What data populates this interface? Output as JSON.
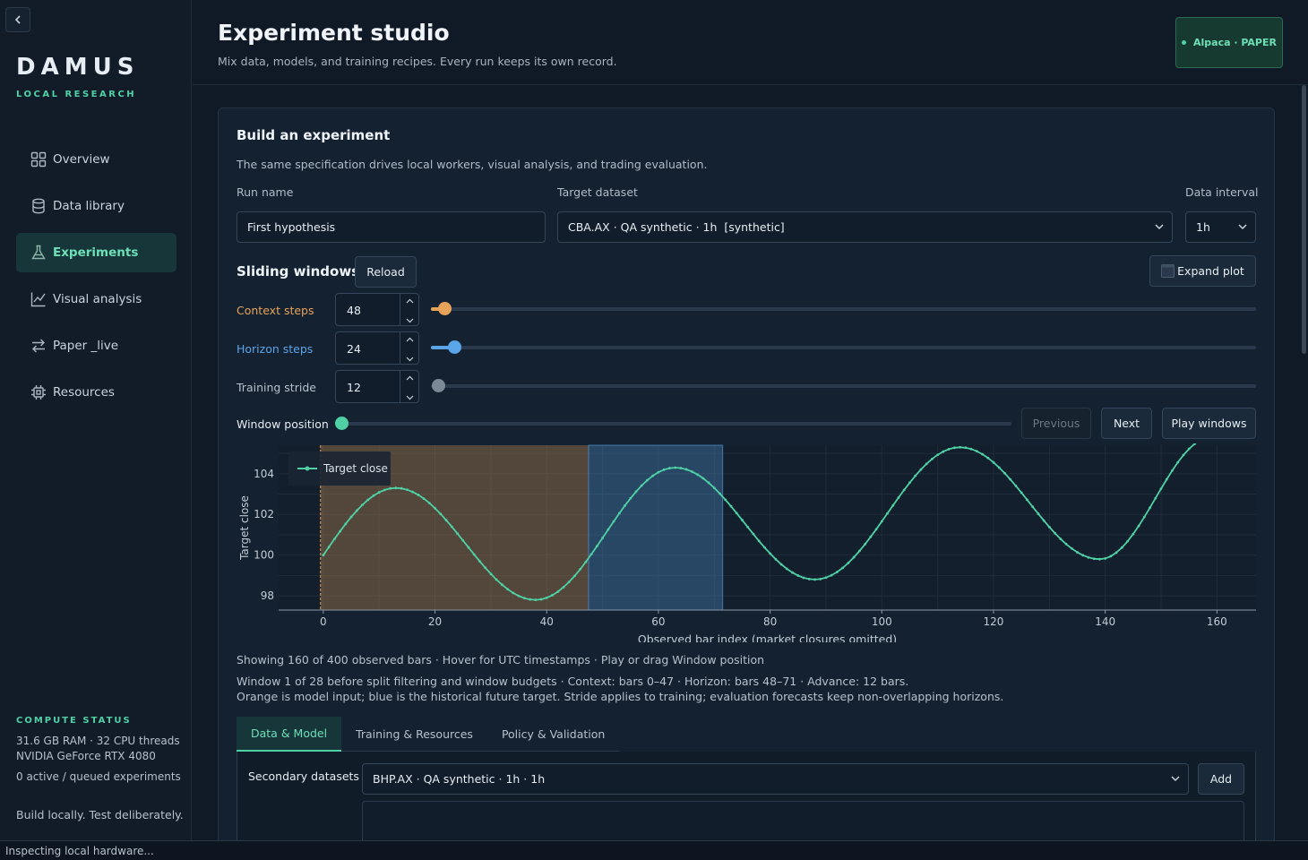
{
  "sidebar": {
    "brand": "DAMUS",
    "brand_sub": "LOCAL RESEARCH",
    "items": [
      {
        "label": "Overview",
        "icon": "grid-icon"
      },
      {
        "label": "Data library",
        "icon": "database-icon"
      },
      {
        "label": "Experiments",
        "icon": "flask-icon"
      },
      {
        "label": "Visual analysis",
        "icon": "line-chart-icon"
      },
      {
        "label": "Paper _live",
        "icon": "swap-arrows-icon"
      },
      {
        "label": "Resources",
        "icon": "chip-icon"
      }
    ],
    "active": "Experiments",
    "compute_title": "COMPUTE STATUS",
    "compute_lines": [
      "31.6 GB RAM · 32 CPU threads",
      "NVIDIA GeForce RTX 4080",
      "0 active / queued experiments"
    ],
    "tagline": "Build locally. Test deliberately."
  },
  "status_bar": "Inspecting local hardware...",
  "header": {
    "title": "Experiment studio",
    "subtitle": "Mix data, models, and training recipes. Every run keeps its own record.",
    "broker_badge": "Alpaca · PAPER"
  },
  "builder": {
    "title": "Build an experiment",
    "description": "The same specification drives local workers, visual analysis, and trading evaluation.",
    "run_name_label": "Run name",
    "run_name_value": "First hypothesis",
    "dataset_label": "Target dataset",
    "dataset_value": "CBA.AX · QA synthetic · 1h  [synthetic]",
    "interval_label": "Data interval",
    "interval_value": "1h"
  },
  "windows": {
    "title": "Sliding windows",
    "reload": "Reload",
    "expand": "Expand plot",
    "context_label": "Context steps",
    "context_value": "48",
    "horizon_label": "Horizon steps",
    "horizon_value": "24",
    "stride_label": "Training stride",
    "stride_value": "12",
    "position_label": "Window position",
    "previous": "Previous",
    "next": "Next",
    "play": "Play windows",
    "colors": {
      "context": "#e8a35a",
      "horizon": "#5aa5e8",
      "series": "#4fd1a5"
    }
  },
  "chart_data": {
    "type": "line",
    "xlabel": "Observed bar index (market closures omitted)",
    "ylabel": "Target close",
    "xlim": [
      -8,
      167
    ],
    "ylim": [
      97.3,
      105.4
    ],
    "xticks": [
      0,
      20,
      40,
      60,
      80,
      100,
      120,
      140,
      160
    ],
    "yticks": [
      98,
      100,
      102,
      104
    ],
    "legend": "top-left",
    "context_range": [
      0,
      47
    ],
    "horizon_range": [
      48,
      71
    ],
    "series": [
      {
        "name": "Target close",
        "start_x": 0,
        "end_x": 159,
        "values_formula_hint": "",
        "keypoints": [
          [
            0,
            100.0
          ],
          [
            13,
            103.3
          ],
          [
            38,
            97.8
          ],
          [
            63,
            104.3
          ],
          [
            88,
            98.8
          ],
          [
            114,
            105.3
          ],
          [
            139,
            99.8
          ],
          [
            159,
            105.8
          ]
        ]
      }
    ]
  },
  "info": {
    "showing": "Showing 160 of 400 observed bars · Hover for UTC timestamps · Play or drag Window position",
    "window": "Window 1 of 28 before split filtering and window budgets · Context: bars 0–47 · Horizon: bars 48–71 · Advance: 12 bars.",
    "legend_note": "Orange is model input; blue is the historical future target. Stride applies to training; evaluation forecasts keep non-overlapping horizons."
  },
  "tabs": [
    "Data & Model",
    "Training & Resources",
    "Policy & Validation"
  ],
  "active_tab": "Data & Model",
  "secondary": {
    "label": "Secondary datasets",
    "value": "BHP.AX · QA synthetic · 1h · 1h",
    "add": "Add"
  }
}
